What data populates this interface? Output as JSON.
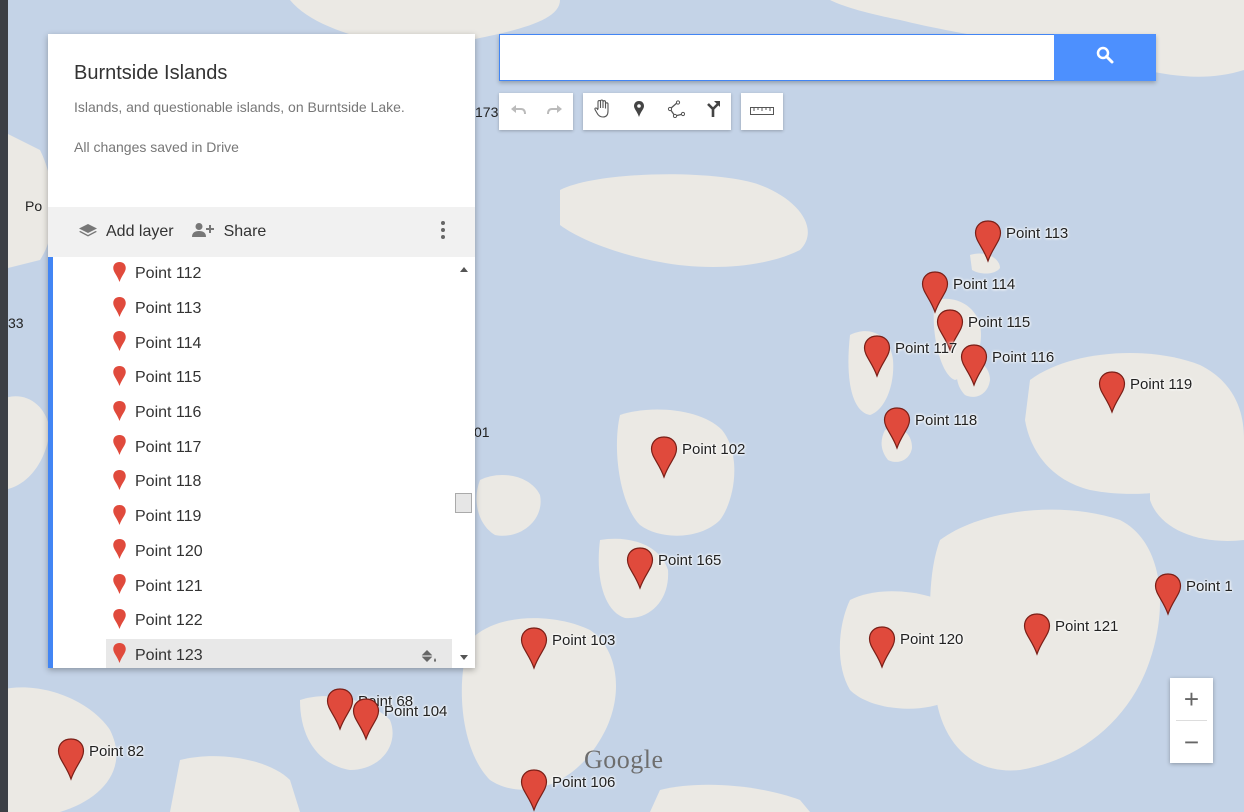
{
  "map": {
    "title": "Burntside Islands",
    "description": "Islands, and questionable islands, on Burntside Lake.",
    "save_status": "All changes saved in Drive",
    "google_logo": "Google",
    "colors": {
      "water": "#c4d3e7",
      "land": "#ebe9e4",
      "pin": "#e04a3c",
      "accent": "#4285f4",
      "search_button": "#4d90fe"
    }
  },
  "layer_bar": {
    "add_layer": "Add layer",
    "share": "Share",
    "add_layer_icon": "layers-icon",
    "share_icon": "add-person-icon",
    "menu_icon": "more-vert-icon"
  },
  "layer_list": {
    "items": [
      "Point 112",
      "Point 113",
      "Point 114",
      "Point 115",
      "Point 116",
      "Point 117",
      "Point 118",
      "Point 119",
      "Point 120",
      "Point 121",
      "Point 122",
      "Point 123"
    ],
    "selected": "Point 123",
    "selected_action_icon": "paint-bucket-icon"
  },
  "search": {
    "value": "",
    "placeholder": "",
    "button_icon": "search-icon"
  },
  "toolbar": {
    "buttons": [
      "undo-icon",
      "redo-icon",
      "hand-pan-icon",
      "add-marker-icon",
      "draw-line-icon",
      "directions-icon",
      "ruler-icon"
    ]
  },
  "zoom": {
    "in_label": "+",
    "out_label": "−"
  },
  "map_markers": [
    "Point 113",
    "Point 114",
    "Point 115",
    "Point 117",
    "Point 116",
    "Point 119",
    "Point 118",
    "Point 102",
    "Point 165",
    "Point 103",
    "Point 120",
    "Point 121",
    "Point 1",
    "Point 68",
    "Point 104",
    "Point 82",
    "Point 106"
  ],
  "edge_labels": [
    "Po",
    "33",
    "173",
    "01"
  ]
}
